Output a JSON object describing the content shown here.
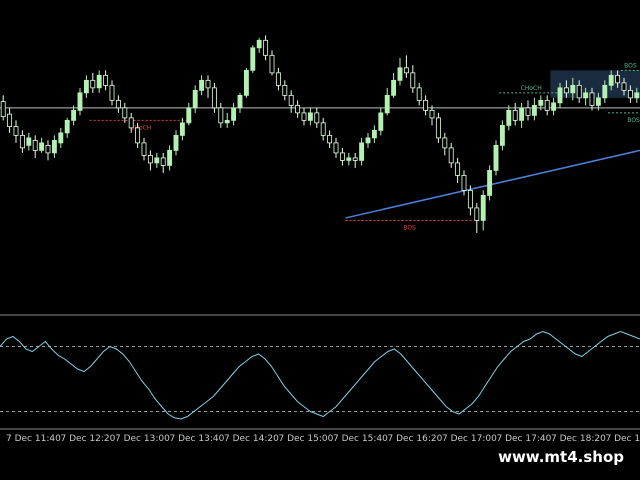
{
  "watermark": "www.mt4.shop",
  "colors": {
    "background": "#000000",
    "bull_candle": "#b4f0b4",
    "bear_candle": "#e6ffe6",
    "bull_fill": "#b4f0b4",
    "bear_fill": "#000000",
    "separator": "#888888",
    "trendline": "#4f7fd8",
    "horizontal_line": "#c0c0c0",
    "choch_bear": "#e04040",
    "choch_bull": "#4fb890",
    "bos_bear": "#e04040",
    "bos_bull": "#4fb890",
    "zone": "#1a2a3f",
    "oscillator": "#7fd0e8",
    "levels": "#9a9a9a"
  },
  "annotations": [
    {
      "text": "CHoCH",
      "side": "bear"
    },
    {
      "text": "BOS",
      "side": "bear"
    },
    {
      "text": "CHoCH",
      "side": "bull"
    },
    {
      "text": "BOS",
      "side": "bull"
    },
    {
      "text": "BOS",
      "side": "bull_low"
    }
  ],
  "time_labels": [
    "7 Dec 11:40",
    "7 Dec 12:20",
    "7 Dec 13:00",
    "7 Dec 13:40",
    "7 Dec 14:20",
    "7 Dec 15:00",
    "7 Dec 15:40",
    "7 Dec 16:20",
    "7 Dec 17:00",
    "7 Dec 17:40",
    "7 Dec 18:20",
    "7 Dec 19:00"
  ],
  "candles": [
    [
      165,
      153,
      170,
      150
    ],
    [
      155,
      145,
      160,
      140
    ],
    [
      145,
      138,
      150,
      132
    ],
    [
      138,
      128,
      142,
      124
    ],
    [
      130,
      136,
      140,
      126
    ],
    [
      134,
      126,
      138,
      120
    ],
    [
      126,
      132,
      136,
      124
    ],
    [
      130,
      124,
      134,
      118
    ],
    [
      124,
      134,
      138,
      120
    ],
    [
      132,
      140,
      144,
      128
    ],
    [
      140,
      150,
      152,
      136
    ],
    [
      150,
      158,
      162,
      146
    ],
    [
      158,
      172,
      176,
      154
    ],
    [
      172,
      182,
      186,
      168
    ],
    [
      182,
      176,
      188,
      172
    ],
    [
      176,
      186,
      190,
      172
    ],
    [
      186,
      178,
      190,
      174
    ],
    [
      178,
      166,
      182,
      162
    ],
    [
      166,
      160,
      170,
      156
    ],
    [
      160,
      152,
      164,
      148
    ],
    [
      152,
      144,
      156,
      140
    ],
    [
      144,
      132,
      148,
      128
    ],
    [
      132,
      122,
      136,
      118
    ],
    [
      122,
      116,
      126,
      110
    ],
    [
      116,
      120,
      124,
      112
    ],
    [
      120,
      114,
      124,
      108
    ],
    [
      114,
      126,
      130,
      110
    ],
    [
      126,
      138,
      142,
      122
    ],
    [
      138,
      148,
      152,
      134
    ],
    [
      148,
      160,
      164,
      146
    ],
    [
      160,
      174,
      178,
      156
    ],
    [
      174,
      182,
      186,
      170
    ],
    [
      182,
      176,
      186,
      168
    ],
    [
      176,
      160,
      180,
      156
    ],
    [
      160,
      148,
      164,
      144
    ],
    [
      148,
      150,
      156,
      144
    ],
    [
      150,
      160,
      164,
      146
    ],
    [
      160,
      170,
      172,
      156
    ],
    [
      170,
      190,
      192,
      168
    ],
    [
      190,
      208,
      210,
      188
    ],
    [
      208,
      214,
      216,
      204
    ],
    [
      214,
      202,
      218,
      198
    ],
    [
      202,
      188,
      206,
      186
    ],
    [
      188,
      178,
      192,
      174
    ],
    [
      178,
      170,
      182,
      166
    ],
    [
      170,
      162,
      174,
      156
    ],
    [
      162,
      156,
      166,
      152
    ],
    [
      156,
      150,
      160,
      146
    ],
    [
      150,
      156,
      160,
      146
    ],
    [
      156,
      148,
      160,
      144
    ],
    [
      148,
      138,
      152,
      134
    ],
    [
      138,
      132,
      142,
      128
    ],
    [
      132,
      124,
      136,
      120
    ],
    [
      124,
      118,
      128,
      114
    ],
    [
      118,
      120,
      124,
      114
    ],
    [
      120,
      118,
      124,
      112
    ],
    [
      118,
      132,
      136,
      114
    ],
    [
      132,
      136,
      140,
      128
    ],
    [
      136,
      142,
      146,
      132
    ],
    [
      142,
      156,
      160,
      138
    ],
    [
      156,
      170,
      176,
      154
    ],
    [
      170,
      182,
      188,
      168
    ],
    [
      182,
      192,
      200,
      178
    ],
    [
      192,
      188,
      202,
      184
    ],
    [
      188,
      176,
      194,
      172
    ],
    [
      176,
      166,
      180,
      162
    ],
    [
      166,
      158,
      170,
      154
    ],
    [
      158,
      152,
      162,
      146
    ],
    [
      152,
      136,
      156,
      132
    ],
    [
      136,
      128,
      140,
      122
    ],
    [
      128,
      116,
      132,
      112
    ],
    [
      116,
      106,
      120,
      100
    ],
    [
      106,
      94,
      110,
      90
    ],
    [
      94,
      80,
      98,
      74
    ],
    [
      80,
      70,
      84,
      60
    ],
    [
      70,
      90,
      94,
      62
    ],
    [
      90,
      110,
      114,
      86
    ],
    [
      110,
      130,
      134,
      106
    ],
    [
      130,
      146,
      150,
      126
    ],
    [
      146,
      158,
      162,
      142
    ],
    [
      158,
      150,
      164,
      146
    ],
    [
      150,
      160,
      164,
      144
    ],
    [
      160,
      154,
      166,
      150
    ],
    [
      154,
      162,
      168,
      150
    ],
    [
      162,
      166,
      170,
      158
    ],
    [
      166,
      158,
      170,
      154
    ],
    [
      158,
      164,
      168,
      154
    ],
    [
      164,
      176,
      180,
      160
    ],
    [
      176,
      172,
      182,
      168
    ],
    [
      172,
      178,
      184,
      166
    ],
    [
      178,
      168,
      182,
      164
    ],
    [
      168,
      172,
      176,
      162
    ],
    [
      172,
      162,
      176,
      158
    ],
    [
      162,
      168,
      172,
      158
    ],
    [
      168,
      178,
      182,
      164
    ],
    [
      178,
      186,
      190,
      174
    ],
    [
      186,
      180,
      190,
      176
    ],
    [
      180,
      174,
      184,
      170
    ],
    [
      174,
      168,
      178,
      164
    ],
    [
      168,
      172,
      176,
      164
    ]
  ],
  "oscillator": [
    62,
    68,
    70,
    66,
    60,
    58,
    62,
    66,
    60,
    55,
    52,
    48,
    44,
    42,
    46,
    52,
    58,
    62,
    60,
    56,
    50,
    42,
    34,
    28,
    20,
    14,
    8,
    5,
    4,
    6,
    10,
    14,
    18,
    22,
    28,
    34,
    40,
    46,
    50,
    54,
    56,
    52,
    46,
    38,
    30,
    24,
    18,
    14,
    10,
    8,
    6,
    10,
    14,
    20,
    26,
    32,
    38,
    44,
    50,
    54,
    58,
    60,
    56,
    50,
    44,
    38,
    32,
    26,
    20,
    14,
    10,
    8,
    12,
    16,
    22,
    30,
    38,
    46,
    52,
    58,
    62,
    66,
    68,
    72,
    74,
    72,
    68,
    64,
    60,
    56,
    54,
    58,
    62,
    66,
    70,
    72,
    74,
    72,
    70,
    68
  ]
}
